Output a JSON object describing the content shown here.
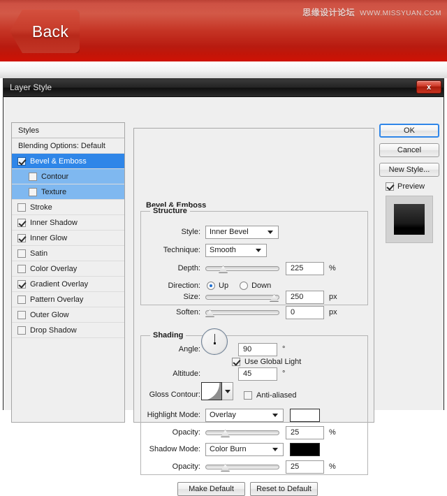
{
  "banner": {
    "back_label": "Back",
    "watermark_cn": "思缘设计论坛",
    "watermark_url": "WWW.MISSYUAN.COM",
    "banner_color": "#c43223"
  },
  "dialog": {
    "title": "Layer Style",
    "close_label": "x"
  },
  "styles_panel": {
    "header": "Styles",
    "blending_options": "Blending Options: Default",
    "items": [
      {
        "label": "Bevel & Emboss",
        "checked": true,
        "selected": true,
        "sub": false
      },
      {
        "label": "Contour",
        "checked": false,
        "selected": false,
        "sub": true
      },
      {
        "label": "Texture",
        "checked": false,
        "selected": false,
        "sub": true
      },
      {
        "label": "Stroke",
        "checked": false,
        "selected": false,
        "sub": false
      },
      {
        "label": "Inner Shadow",
        "checked": true,
        "selected": false,
        "sub": false
      },
      {
        "label": "Inner Glow",
        "checked": true,
        "selected": false,
        "sub": false
      },
      {
        "label": "Satin",
        "checked": false,
        "selected": false,
        "sub": false
      },
      {
        "label": "Color Overlay",
        "checked": false,
        "selected": false,
        "sub": false
      },
      {
        "label": "Gradient Overlay",
        "checked": true,
        "selected": false,
        "sub": false
      },
      {
        "label": "Pattern Overlay",
        "checked": false,
        "selected": false,
        "sub": false
      },
      {
        "label": "Outer Glow",
        "checked": false,
        "selected": false,
        "sub": false
      },
      {
        "label": "Drop Shadow",
        "checked": false,
        "selected": false,
        "sub": false
      }
    ]
  },
  "buttons": {
    "ok": "OK",
    "cancel": "Cancel",
    "new_style": "New Style...",
    "preview": "Preview",
    "preview_checked": true,
    "make_default": "Make Default",
    "reset_to_default": "Reset to Default"
  },
  "panel": {
    "title": "Bevel & Emboss",
    "structure": {
      "title": "Structure",
      "style_label": "Style:",
      "style_value": "Inner Bevel",
      "technique_label": "Technique:",
      "technique_value": "Smooth",
      "depth_label": "Depth:",
      "depth_value": "225",
      "depth_unit": "%",
      "direction_label": "Direction:",
      "direction_up": "Up",
      "direction_down": "Down",
      "direction_selected": "Up",
      "size_label": "Size:",
      "size_value": "250",
      "size_unit": "px",
      "soften_label": "Soften:",
      "soften_value": "0",
      "soften_unit": "px"
    },
    "shading": {
      "title": "Shading",
      "angle_label": "Angle:",
      "angle_value": "90",
      "angle_unit": "°",
      "global_light_label": "Use Global Light",
      "global_light_checked": true,
      "altitude_label": "Altitude:",
      "altitude_value": "45",
      "altitude_unit": "°",
      "gloss_contour_label": "Gloss Contour:",
      "anti_aliased_label": "Anti-aliased",
      "anti_aliased_checked": false,
      "highlight_mode_label": "Highlight Mode:",
      "highlight_mode_value": "Overlay",
      "highlight_color": "#ffffff",
      "highlight_opacity_label": "Opacity:",
      "highlight_opacity_value": "25",
      "highlight_opacity_unit": "%",
      "shadow_mode_label": "Shadow Mode:",
      "shadow_mode_value": "Color Burn",
      "shadow_color": "#000000",
      "shadow_opacity_label": "Opacity:",
      "shadow_opacity_value": "25",
      "shadow_opacity_unit": "%"
    }
  }
}
